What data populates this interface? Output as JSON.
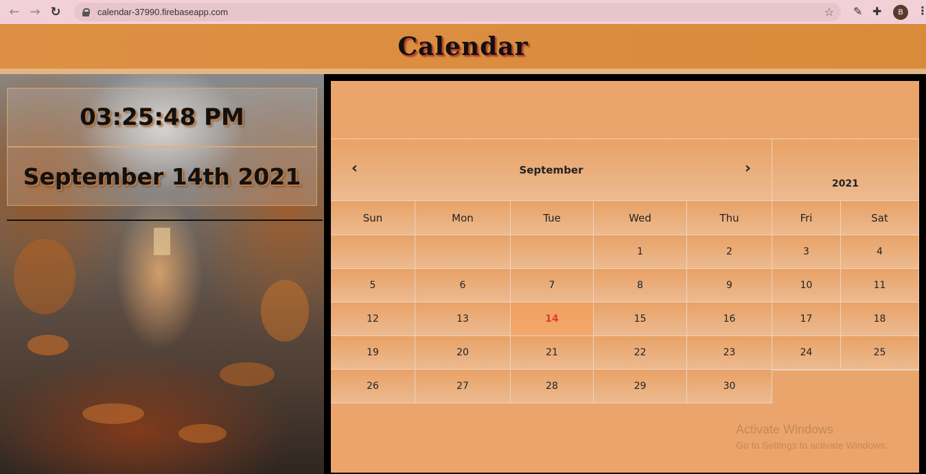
{
  "browser": {
    "url": "calendar-37990.firebaseapp.com",
    "profile_initial": "B"
  },
  "header": {
    "title": "Calendar"
  },
  "clock": {
    "time": "03:25:48 PM",
    "date": "September 14th 2021"
  },
  "calendar": {
    "month": "September",
    "year": "2021",
    "prev_icon": "chevron-left-icon",
    "next_icon": "chevron-right-icon",
    "weekdays": [
      "Sun",
      "Mon",
      "Tue",
      "Wed",
      "Thu",
      "Fri",
      "Sat"
    ],
    "weeks": [
      [
        "",
        "",
        "",
        "1",
        "2",
        "3",
        "4"
      ],
      [
        "5",
        "6",
        "7",
        "8",
        "9",
        "10",
        "11"
      ],
      [
        "12",
        "13",
        "14",
        "15",
        "16",
        "17",
        "18"
      ],
      [
        "19",
        "20",
        "21",
        "22",
        "23",
        "24",
        "25"
      ],
      [
        "26",
        "27",
        "28",
        "29",
        "30",
        "",
        ""
      ]
    ],
    "today": "14",
    "today_color": "#e23b2e",
    "accent_color": "#eba56c"
  },
  "watermark": {
    "title": "Activate Windows",
    "subtitle": "Go to Settings to activate Windows."
  }
}
